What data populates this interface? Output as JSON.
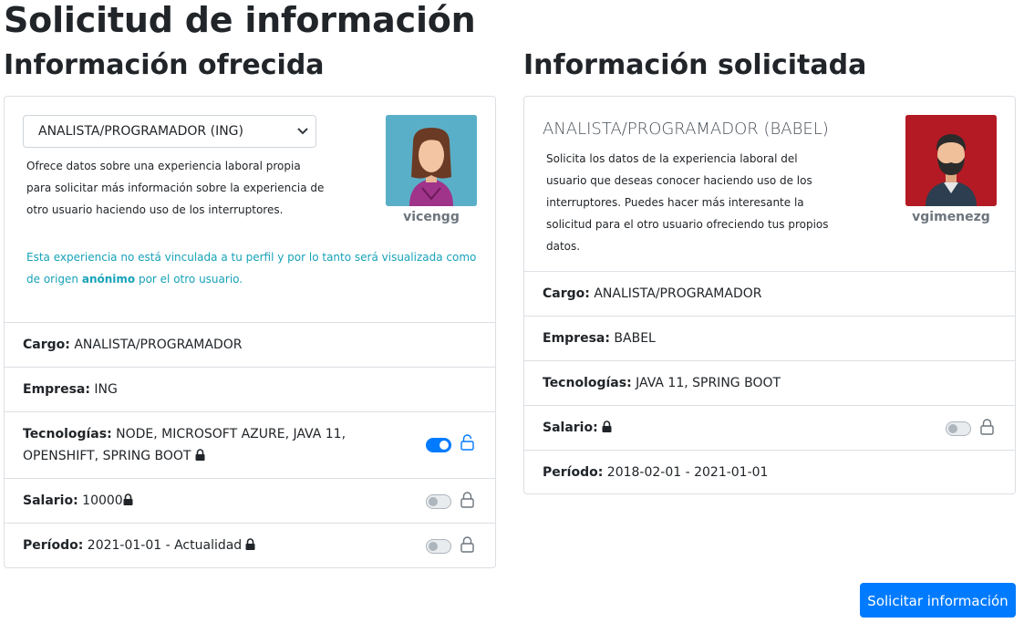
{
  "page_title": "Solicitud de información",
  "offered": {
    "title": "Información ofrecida",
    "select_value": "ANALISTA/PROGRAMADOR (ING)",
    "description": "Ofrece datos sobre una experiencia laboral propia para solicitar más información sobre la experiencia de otro usuario haciendo uso de los interruptores.",
    "info_before": "Esta experiencia no está vinculada a tu perfil y por lo tanto será visualizada como de origen ",
    "info_bold": "anónimo",
    "info_after": " por el otro usuario.",
    "username": "vicengg",
    "avatar_bg": "#5aafc8",
    "rows": [
      {
        "label": "Cargo:",
        "value": "ANALISTA/PROGRAMADOR"
      },
      {
        "label": "Empresa:",
        "value": "ING"
      },
      {
        "label": "Tecnologías:",
        "value": "NODE, MICROSOFT AZURE, JAVA 11, OPENSHIFT, SPRING BOOT",
        "switch": "on",
        "lock": "open"
      },
      {
        "label": "Salario:",
        "value": "10000",
        "switch": "off",
        "lock": "closed"
      },
      {
        "label": "Período:",
        "value": "2021-01-01 - Actualidad",
        "switch": "off",
        "lock": "closed"
      }
    ]
  },
  "requested": {
    "title": "Información solicitada",
    "experience_title": "ANALISTA/PROGRAMADOR (BABEL)",
    "description": "Solicita los datos de la experiencia laboral del usuario que deseas conocer haciendo uso de los interruptores. Puedes hacer más interesante la solicitud para el otro usuario ofreciendo tus propios datos.",
    "username": "vgimenezg",
    "avatar_bg": "#b41a24",
    "rows": [
      {
        "label": "Cargo:",
        "value": "ANALISTA/PROGRAMADOR"
      },
      {
        "label": "Empresa:",
        "value": "BABEL"
      },
      {
        "label": "Tecnologías:",
        "value": "JAVA 11, SPRING BOOT"
      },
      {
        "label": "Salario:",
        "value": "",
        "switch": "off",
        "lock": "closed"
      },
      {
        "label": "Período:",
        "value": "2018-02-01 - 2021-01-01"
      }
    ]
  },
  "submit_label": "Solicitar información",
  "colors": {
    "accent": "#007bff",
    "info": "#17a2b8",
    "border": "#dcdfe3"
  },
  "icons": [
    "chevron-down-icon",
    "lock-icon",
    "unlock-icon",
    "woman-avatar",
    "bearded-man-avatar"
  ]
}
